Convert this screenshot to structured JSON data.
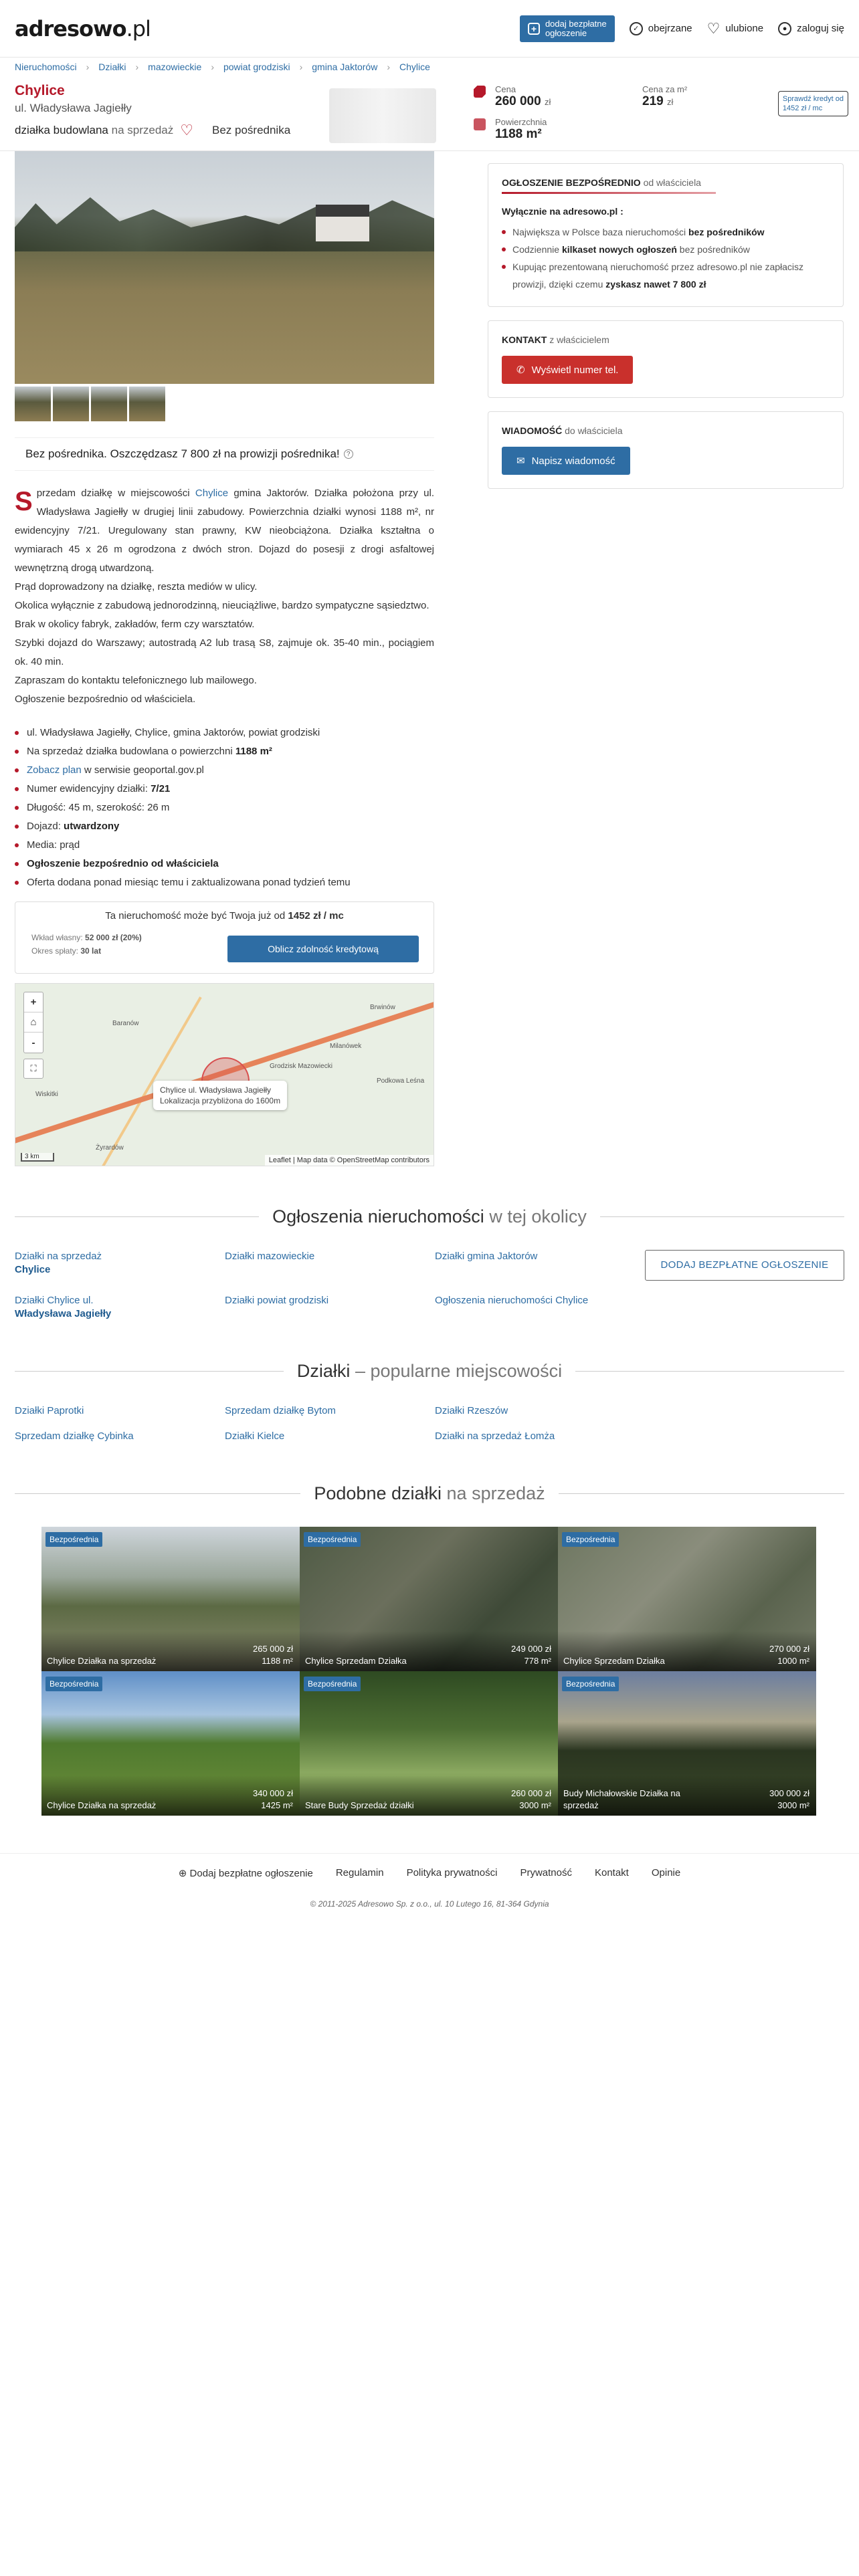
{
  "header": {
    "logo_main": "adresowo",
    "logo_tld": ".pl",
    "add_btn_line1": "dodaj bezpłatne",
    "add_btn_line2": "ogłoszenie",
    "observed": "obejrzane",
    "favorites": "ulubione",
    "login": "zaloguj się"
  },
  "breadcrumb": [
    "Nieruchomości",
    "Działki",
    "mazowieckie",
    "powiat grodziski",
    "gmina Jaktorów",
    "Chylice"
  ],
  "listing": {
    "city": "Chylice",
    "street": "ul. Władysława Jagiełły",
    "type_bold": "działka budowlana",
    "type_rest": "na sprzedaż",
    "agency": "Bez pośrednika"
  },
  "prices": {
    "price_label": "Cena",
    "price_value": "260 000",
    "price_unit": "zł",
    "per_m2_label": "Cena za m²",
    "per_m2_value": "219",
    "per_m2_unit": "zł",
    "area_label": "Powierzchnia",
    "area_value": "1188 m²",
    "credit_line1": "Sprawdź kredyt od",
    "credit_line2": "1452 zł / mc"
  },
  "save_bar": "Bez pośrednika. Oszczędzasz 7 800 zł na prowizji pośrednika!",
  "description": [
    "przedam działkę w miejscowości",
    "Chylice",
    "gmina Jaktorów. Działka położona przy ul. Władysława Jagiełły w drugiej linii zabudowy. Powierzchnia działki wynosi 1188 m², nr ewidencyjny 7/21. Uregulowany stan prawny, KW nieobciążona. Działka kształtna o wymiarach 45 x 26 m ogrodzona z dwóch stron. Dojazd do posesji z drogi asfaltowej wewnętrzną drogą utwardzoną.",
    "Prąd doprowadzony na działkę, reszta mediów w ulicy.",
    "Okolica wyłącznie z zabudową jednorodzinną, nieuciążliwe, bardzo sympatyczne sąsiedztwo.",
    "Brak w okolicy fabryk, zakładów, ferm czy warsztatów.",
    "Szybki dojazd do Warszawy; autostradą A2 lub trasą S8, zajmuje ok. 35-40 min., pociągiem ok. 40 min.",
    "Zapraszam do kontaktu telefonicznego lub mailowego.",
    "Ogłoszenie bezpośrednio od właściciela."
  ],
  "dropcap": "S",
  "facts": {
    "f1": "ul. Władysława Jagiełły, Chylice, gmina Jaktorów, powiat grodziski",
    "f2_a": "Na sprzedaż działka budowlana o powierzchni",
    "f2_b": "1188 m²",
    "f3_link": "Zobacz plan",
    "f3_rest": "w serwisie geoportal.gov.pl",
    "f4_a": "Numer ewidencyjny działki:",
    "f4_b": "7/21",
    "f5": "Długość: 45 m, szerokość: 26 m",
    "f6_a": "Dojazd:",
    "f6_b": "utwardzony",
    "f7": "Media: prąd",
    "f8": "Ogłoszenie bezpośrednio od właściciela",
    "f9": "Oferta dodana ponad miesiąc temu i zaktualizowana ponad tydzień temu"
  },
  "mortgage": {
    "title_a": "Ta nieruchomość może być Twoja już od",
    "title_b": "1452 zł / mc",
    "own_label": "Wkład własny:",
    "own_value": "52 000 zł (20%)",
    "period_label": "Okres spłaty:",
    "period_value": "30 lat",
    "button": "Oblicz zdolność kredytową"
  },
  "map": {
    "popup_line1": "Chylice ul. Władysława Jagiełły",
    "popup_line2": "Lokalizacja przybliżona do 1600m",
    "attribution": "Leaflet | Map data © OpenStreetMap contributors",
    "scale": "3 km",
    "zoom_in": "+",
    "zoom_out": "-",
    "places": [
      "Grodzisk Mazowiecki",
      "Milanówek",
      "Brwinów",
      "Podkowa Leśna",
      "Baranów",
      "Żyrardów",
      "Wiskitki"
    ]
  },
  "owner_box": {
    "title_a": "OGŁOSZENIE BEZPOŚREDNIO",
    "title_b": "od właściciela",
    "exclusive": "Wyłącznie na adresowo.pl :",
    "b1_a": "Największa w Polsce baza nieruchomości",
    "b1_b": "bez pośredników",
    "b2_a": "Codziennie",
    "b2_b": "kilkaset nowych ogłoszeń",
    "b2_c": "bez pośredników",
    "b3_a": "Kupując prezentowaną nieruchomość przez adresowo.pl nie zapłacisz prowizji, dzięki czemu",
    "b3_b": "zyskasz nawet 7 800 zł"
  },
  "contact_box": {
    "title_a": "KONTAKT",
    "title_b": "z właścicielem",
    "button": "Wyświetl numer tel."
  },
  "message_box": {
    "title_a": "WIADOMOŚĆ",
    "title_b": "do właściciela",
    "button": "Napisz wiadomość"
  },
  "nearby": {
    "title_a": "Ogłoszenia nieruchomości",
    "title_b": "w tej okolicy",
    "links": [
      {
        "a": "Działki na sprzedaż",
        "b": "Chylice"
      },
      {
        "a": "Działki mazowieckie",
        "b": ""
      },
      {
        "a": "Działki gmina Jaktorów",
        "b": ""
      },
      {
        "a": "Działki Chylice ul.",
        "b": "Władysława Jagiełły"
      },
      {
        "a": "Działki powiat grodziski",
        "b": ""
      },
      {
        "a": "Ogłoszenia nieruchomości Chylice",
        "b": ""
      }
    ],
    "add_button": "DODAJ BEZPŁATNE OGŁOSZENIE"
  },
  "popular": {
    "title_a": "Działki",
    "title_b": "– popularne miejscowości",
    "links": [
      "Działki Paprotki",
      "Sprzedam działkę Bytom",
      "Działki Rzeszów",
      "Sprzedam działkę Cybinka",
      "Działki Kielce",
      "Działki na sprzedaż Łomża"
    ]
  },
  "similar": {
    "title_a": "Podobne działki",
    "title_b": "na sprzedaż",
    "badge": "Bezpośrednia",
    "cards": [
      {
        "title": "Chylice Działka na sprzedaż",
        "price": "265 000 zł",
        "area": "1188 m²"
      },
      {
        "title": "Chylice Sprzedam Działka",
        "price": "249 000 zł",
        "area": "778 m²"
      },
      {
        "title": "Chylice Sprzedam Działka",
        "price": "270 000 zł",
        "area": "1000 m²"
      },
      {
        "title": "Chylice Działka na sprzedaż",
        "price": "340 000 zł",
        "area": "1425 m²"
      },
      {
        "title": "Stare Budy Sprzedaż działki",
        "price": "260 000 zł",
        "area": "3000 m²"
      },
      {
        "title": "Budy Michałowskie Działka na sprzedaż",
        "price": "300 000 zł",
        "area": "3000 m²"
      }
    ]
  },
  "footer": {
    "links": [
      "Dodaj bezpłatne ogłoszenie",
      "Regulamin",
      "Polityka prywatności",
      "Prywatność",
      "Kontakt",
      "Opinie"
    ],
    "copyright": "© 2011-2025 Adresowo Sp. z o.o., ul. 10 Lutego 16, 81-364 Gdynia"
  }
}
